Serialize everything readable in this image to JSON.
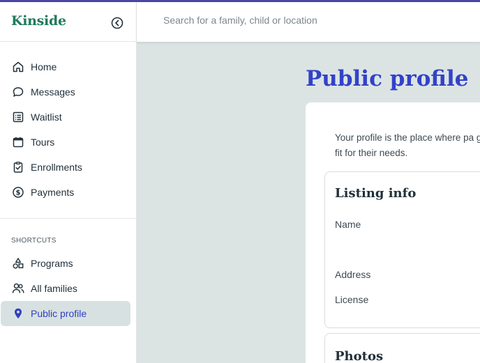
{
  "app": {
    "brand": "Kinside"
  },
  "search": {
    "placeholder": "Search for a family, child or location"
  },
  "sidebar": {
    "items": [
      {
        "label": "Home",
        "icon": "home-icon"
      },
      {
        "label": "Messages",
        "icon": "chat-bubble-icon"
      },
      {
        "label": "Waitlist",
        "icon": "list-icon"
      },
      {
        "label": "Tours",
        "icon": "calendar-icon"
      },
      {
        "label": "Enrollments",
        "icon": "clipboard-check-icon"
      },
      {
        "label": "Payments",
        "icon": "dollar-circle-icon"
      }
    ],
    "shortcuts_label": "SHORTCUTS",
    "shortcuts": [
      {
        "label": "Programs",
        "icon": "shapes-icon"
      },
      {
        "label": "All families",
        "icon": "users-icon"
      },
      {
        "label": "Public profile",
        "icon": "location-pin-icon",
        "active": true
      }
    ]
  },
  "main": {
    "title": "Public profile",
    "intro": "Your profile is the place where pa good fit for their needs.",
    "listing": {
      "title": "Listing info",
      "fields": [
        "Name",
        "Address",
        "License"
      ]
    },
    "photos": {
      "title": "Photos"
    }
  },
  "colors": {
    "brand": "#1f7a5a",
    "accent": "#3242c9",
    "active_bg": "#d8e1e2",
    "background": "#dce4e3"
  }
}
